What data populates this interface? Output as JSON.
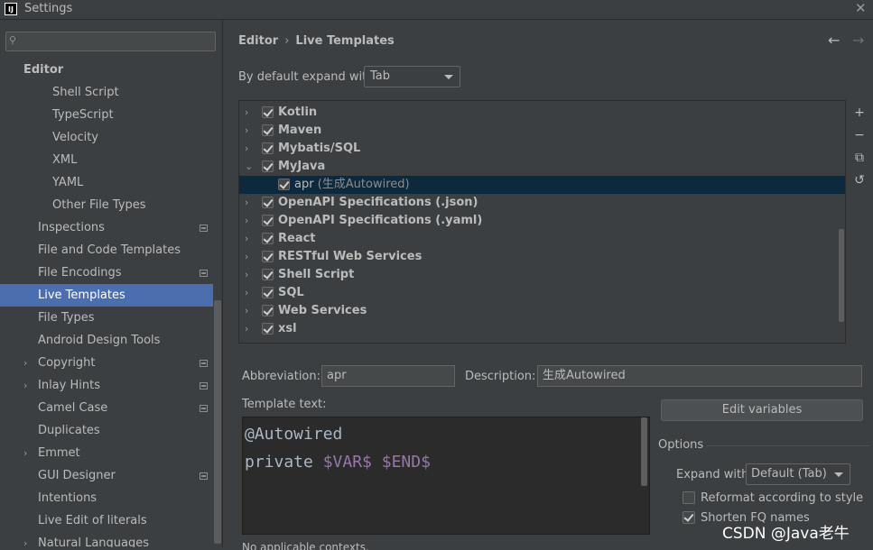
{
  "window": {
    "title": "Settings",
    "app_icon_text": "IJ",
    "close_icon": "close-icon"
  },
  "sidebar": {
    "search": {
      "value": "",
      "placeholder": ""
    },
    "section": "Editor",
    "items": [
      {
        "label": "Shell Script"
      },
      {
        "label": "TypeScript"
      },
      {
        "label": "Velocity"
      },
      {
        "label": "XML"
      },
      {
        "label": "YAML"
      },
      {
        "label": "Other File Types"
      },
      {
        "label": "Inspections"
      },
      {
        "label": "File and Code Templates"
      },
      {
        "label": "File Encodings"
      },
      {
        "label": "Live Templates"
      },
      {
        "label": "File Types"
      },
      {
        "label": "Android Design Tools"
      },
      {
        "label": "Copyright"
      },
      {
        "label": "Inlay Hints"
      },
      {
        "label": "Camel Case"
      },
      {
        "label": "Duplicates"
      },
      {
        "label": "Emmet"
      },
      {
        "label": "GUI Designer"
      },
      {
        "label": "Intentions"
      },
      {
        "label": "Live Edit of literals"
      },
      {
        "label": "Natural Languages"
      }
    ],
    "selected": "Live Templates"
  },
  "breadcrumb": {
    "parent": "Editor",
    "separator": "›",
    "current": "Live Templates"
  },
  "nav": {
    "back": "←",
    "forward": "→"
  },
  "expand_default": {
    "label": "By default expand with",
    "value": "Tab"
  },
  "tree": {
    "groups": [
      {
        "name": "Kotlin"
      },
      {
        "name": "Maven"
      },
      {
        "name": "Mybatis/SQL"
      },
      {
        "name": "MyJava"
      },
      {
        "name": "apr",
        "desc": "(生成Autowired)"
      },
      {
        "name": "OpenAPI Specifications (.json)"
      },
      {
        "name": "OpenAPI Specifications (.yaml)"
      },
      {
        "name": "React"
      },
      {
        "name": "RESTful Web Services"
      },
      {
        "name": "Shell Script"
      },
      {
        "name": "SQL"
      },
      {
        "name": "Web Services"
      },
      {
        "name": "xsl"
      }
    ],
    "tools": {
      "add": "+",
      "remove": "−",
      "copy": "⧉",
      "restore": "↺"
    }
  },
  "abbreviation": {
    "label": "Abbreviation:",
    "value": "apr"
  },
  "description": {
    "label": "Description:",
    "value": "生成Autowired"
  },
  "template_text": {
    "label": "Template text:",
    "line1": "@Autowired",
    "line2_plain": "private ",
    "var1": "$VAR$",
    "space": " ",
    "var2": "$END$"
  },
  "edit_variables": {
    "label": "Edit variables"
  },
  "options": {
    "title": "Options",
    "expand_with_label": "Expand with",
    "expand_with_value": "Default (Tab)",
    "reformat": {
      "label": "Reformat according to style",
      "checked": false
    },
    "shorten": {
      "label": "Shorten FQ names",
      "checked": true
    }
  },
  "applicable": {
    "text": "No applicable contexts."
  },
  "watermark": "CSDN @Java老牛"
}
